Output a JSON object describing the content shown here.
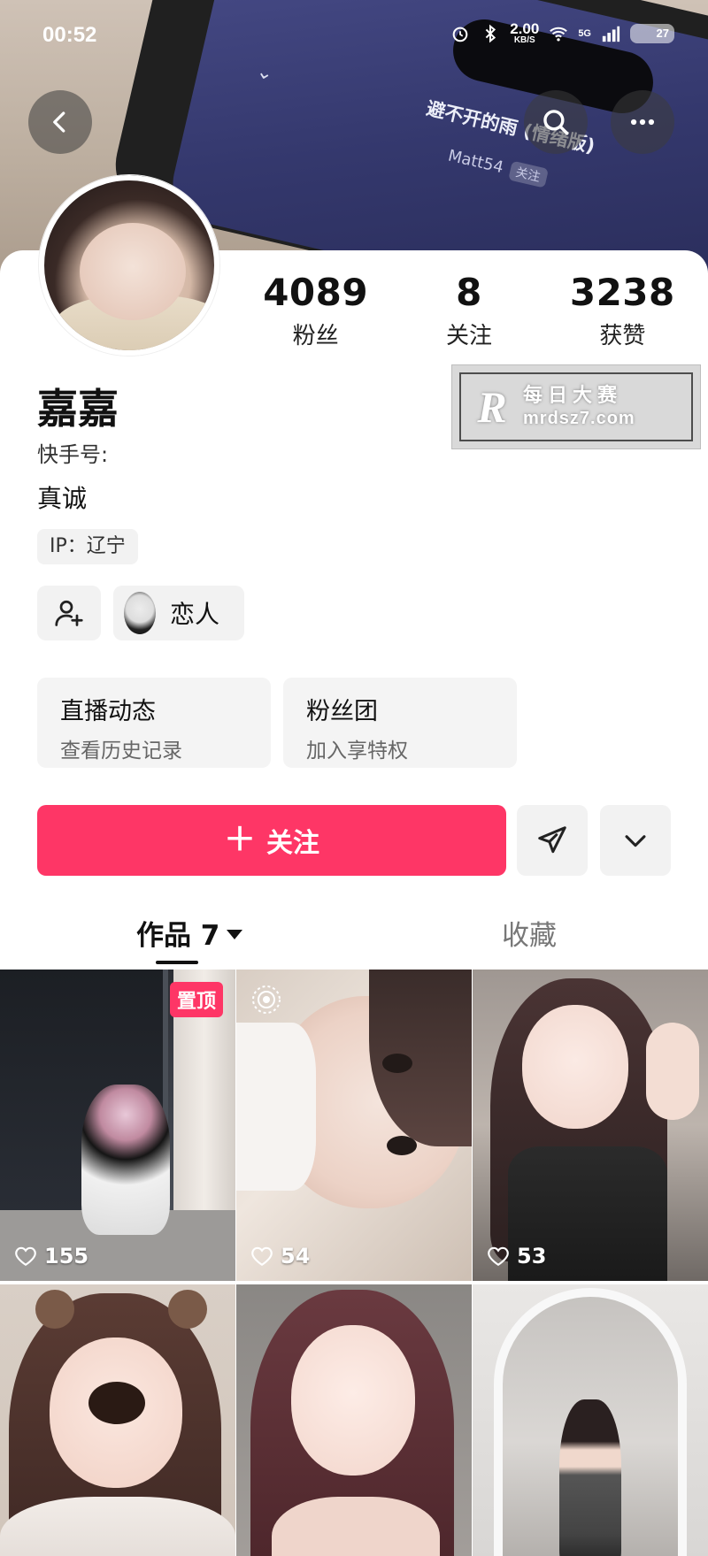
{
  "status_bar": {
    "time": "00:52",
    "net_speed_value": "2.00",
    "net_speed_unit": "KB/S",
    "battery": "27",
    "network": "5G"
  },
  "cover": {
    "song_title": "避不开的雨 (情绪版)",
    "artist": "Matt54",
    "artist_follow": "关注"
  },
  "header": {
    "back_icon": "chevron-left-icon",
    "search_icon": "search-icon",
    "more_icon": "more-dots-icon"
  },
  "profile": {
    "name": "嘉嘉",
    "kuaishou_id_label": "快手号:",
    "bio": "真诚",
    "ip_label": "IP：辽宁"
  },
  "stats": [
    {
      "value": "4089",
      "label": "粉丝"
    },
    {
      "value": "8",
      "label": "关注"
    },
    {
      "value": "3238",
      "label": "获赞"
    }
  ],
  "watermark": {
    "logo": "R",
    "text_cn": "每日大赛",
    "url": "mrdsz7.com"
  },
  "relation": {
    "add_friend_icon": "add-user-icon",
    "label": "恋人"
  },
  "features": {
    "live": {
      "title": "直播动态",
      "subtitle": "查看历史记录"
    },
    "fans": {
      "title": "粉丝团",
      "subtitle": "加入享特权"
    }
  },
  "actions": {
    "follow_label": "关注",
    "follow_color": "#fe3666",
    "send_icon": "send-icon",
    "expand_icon": "chevron-down-icon"
  },
  "tabs": {
    "works_label": "作品 7",
    "favorites_label": "收藏"
  },
  "posts": [
    {
      "likes": "155",
      "pinned_label": "置顶"
    },
    {
      "likes": "54"
    },
    {
      "likes": "53"
    },
    {},
    {},
    {}
  ]
}
